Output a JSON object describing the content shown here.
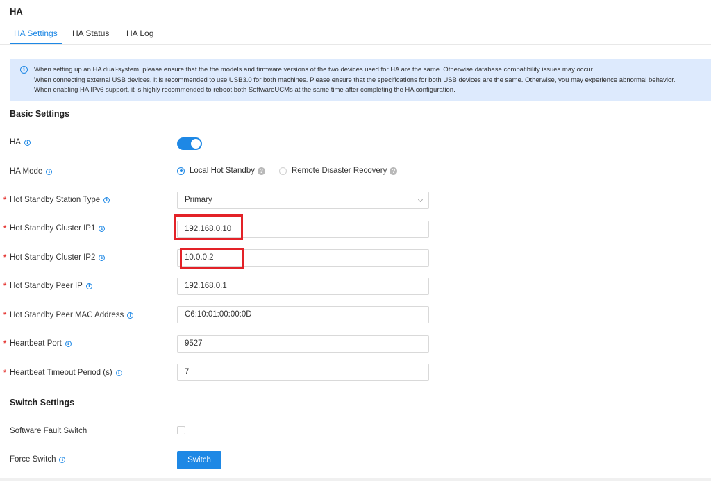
{
  "page": {
    "title": "HA"
  },
  "tabs": [
    {
      "label": "HA Settings",
      "active": true
    },
    {
      "label": "HA Status",
      "active": false
    },
    {
      "label": "HA Log",
      "active": false
    }
  ],
  "notice": {
    "icon": "info-circle-icon",
    "lines": [
      "When setting up an HA dual-system, please ensure that the the models and firmware versions of the two devices used for HA are the same. Otherwise database compatibility issues may occur.",
      "When connecting external USB devices, it is recommended to use USB3.0 for both machines. Please ensure that the specifications for both USB devices are the same. Otherwise, you may experience abnormal behavior.",
      "When enabling HA IPv6 support, it is highly recommended to reboot both SoftwareUCMs at the same time after completing the HA configuration."
    ]
  },
  "basic": {
    "title": "Basic Settings",
    "ha": {
      "label": "HA",
      "enabled": true
    },
    "ha_mode": {
      "label": "HA Mode",
      "options": [
        {
          "label": "Local Hot Standby",
          "checked": true
        },
        {
          "label": "Remote Disaster Recovery",
          "checked": false
        }
      ]
    },
    "station_type": {
      "label": "Hot Standby Station Type",
      "value": "Primary"
    },
    "cluster_ip1": {
      "label": "Hot Standby Cluster IP1",
      "value": "192.168.0.10"
    },
    "cluster_ip2": {
      "label": "Hot Standby Cluster IP2",
      "value": "10.0.0.2"
    },
    "peer_ip": {
      "label": "Hot Standby Peer IP",
      "value": "192.168.0.1"
    },
    "peer_mac": {
      "label": "Hot Standby Peer MAC Address",
      "value": "C6:10:01:00:00:0D"
    },
    "heartbeat_port": {
      "label": "Heartbeat Port",
      "value": "9527"
    },
    "heartbeat_timeout": {
      "label": "Heartbeat Timeout Period (s)",
      "value": "7"
    }
  },
  "switch": {
    "title": "Switch Settings",
    "software_fault": {
      "label": "Software Fault Switch",
      "checked": false
    },
    "force_switch": {
      "label": "Force Switch",
      "button": "Switch"
    }
  },
  "colors": {
    "accent": "#1e88e5",
    "highlight": "#e32228",
    "notice_bg": "#ddeafd",
    "required": "#e53935"
  }
}
